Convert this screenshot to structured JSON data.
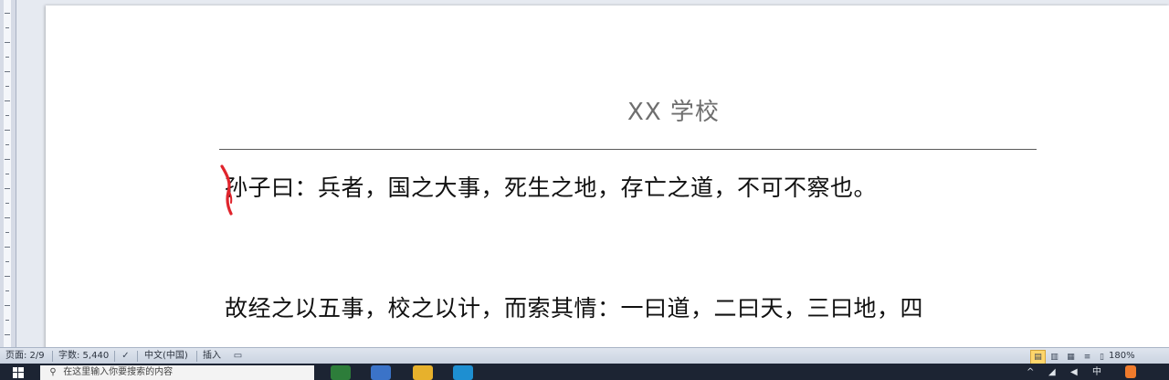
{
  "document": {
    "header": "XX 学校",
    "paragraphs": [
      "孙子曰：兵者，国之大事，死生之地，存亡之道，不可不察也。",
      "故经之以五事，校之以计，而索其情：一曰道，二曰天，三曰地，四"
    ]
  },
  "statusbar": {
    "page": "页面: 2/9",
    "words": "字数: 5,440",
    "language": "中文(中国)",
    "mode": "插入",
    "zoom": "180%"
  },
  "taskbar": {
    "search_placeholder": "在这里输入你要搜索的内容"
  },
  "colors": {
    "pen_mark": "#e0242c",
    "taskbar": "#1c2433",
    "status_bar": "#d4dbe6"
  }
}
